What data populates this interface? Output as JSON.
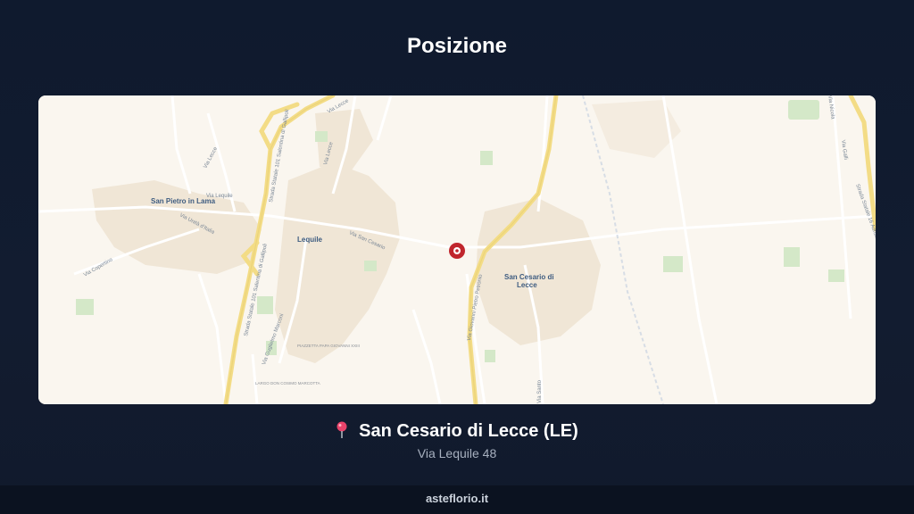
{
  "header": {
    "title": "Posizione"
  },
  "map": {
    "places": {
      "san_pietro": "San Pietro in Lama",
      "lequile": "Lequile",
      "san_cesario_1": "San Cesario di",
      "san_cesario_2": "Lecce"
    },
    "streets": {
      "via_lecce_1": "Via Lecce",
      "via_lecce_2": "Via Lecce",
      "via_lequile": "Via Lequile",
      "via_unita": "Via Unità d'Italia",
      "via_copertino": "Via Copertino",
      "via_san_cesario": "Via San Cesario",
      "ss_galipoli_1": "Strada Statale 101 Salentina di Gallipoli",
      "ss_galipoli_2": "Strada Statale 101 Salentina di Gallipoli",
      "via_marconi": "Via Guglielmo Marconi",
      "via_petronio": "Via Giovanni Pietro Petronio",
      "via_santo": "Via Santo",
      "via_galli": "Via Galli",
      "via_nicola": "Via Nicola",
      "strada_statale_right": "Strada Statale 16 Adriatica",
      "via_lecce_top": "Via Lecce"
    },
    "pois": {
      "piazzetta": "PIAZZETTA PAPA GIOVANNI XXIII",
      "largo": "LARGO DON COSIMO MARCOTTA"
    },
    "marker": "location-marker",
    "colors": {
      "land": "#faf6ef",
      "urban": "#efe4d2",
      "highway": "#f3dd8a",
      "park": "#cfe6c4",
      "marker": "#c0262d"
    }
  },
  "location": {
    "icon": "pin-icon",
    "name": "San Cesario di Lecce (LE)",
    "address": "Via Lequile 48"
  },
  "footer": {
    "site": "asteflorio.it"
  }
}
